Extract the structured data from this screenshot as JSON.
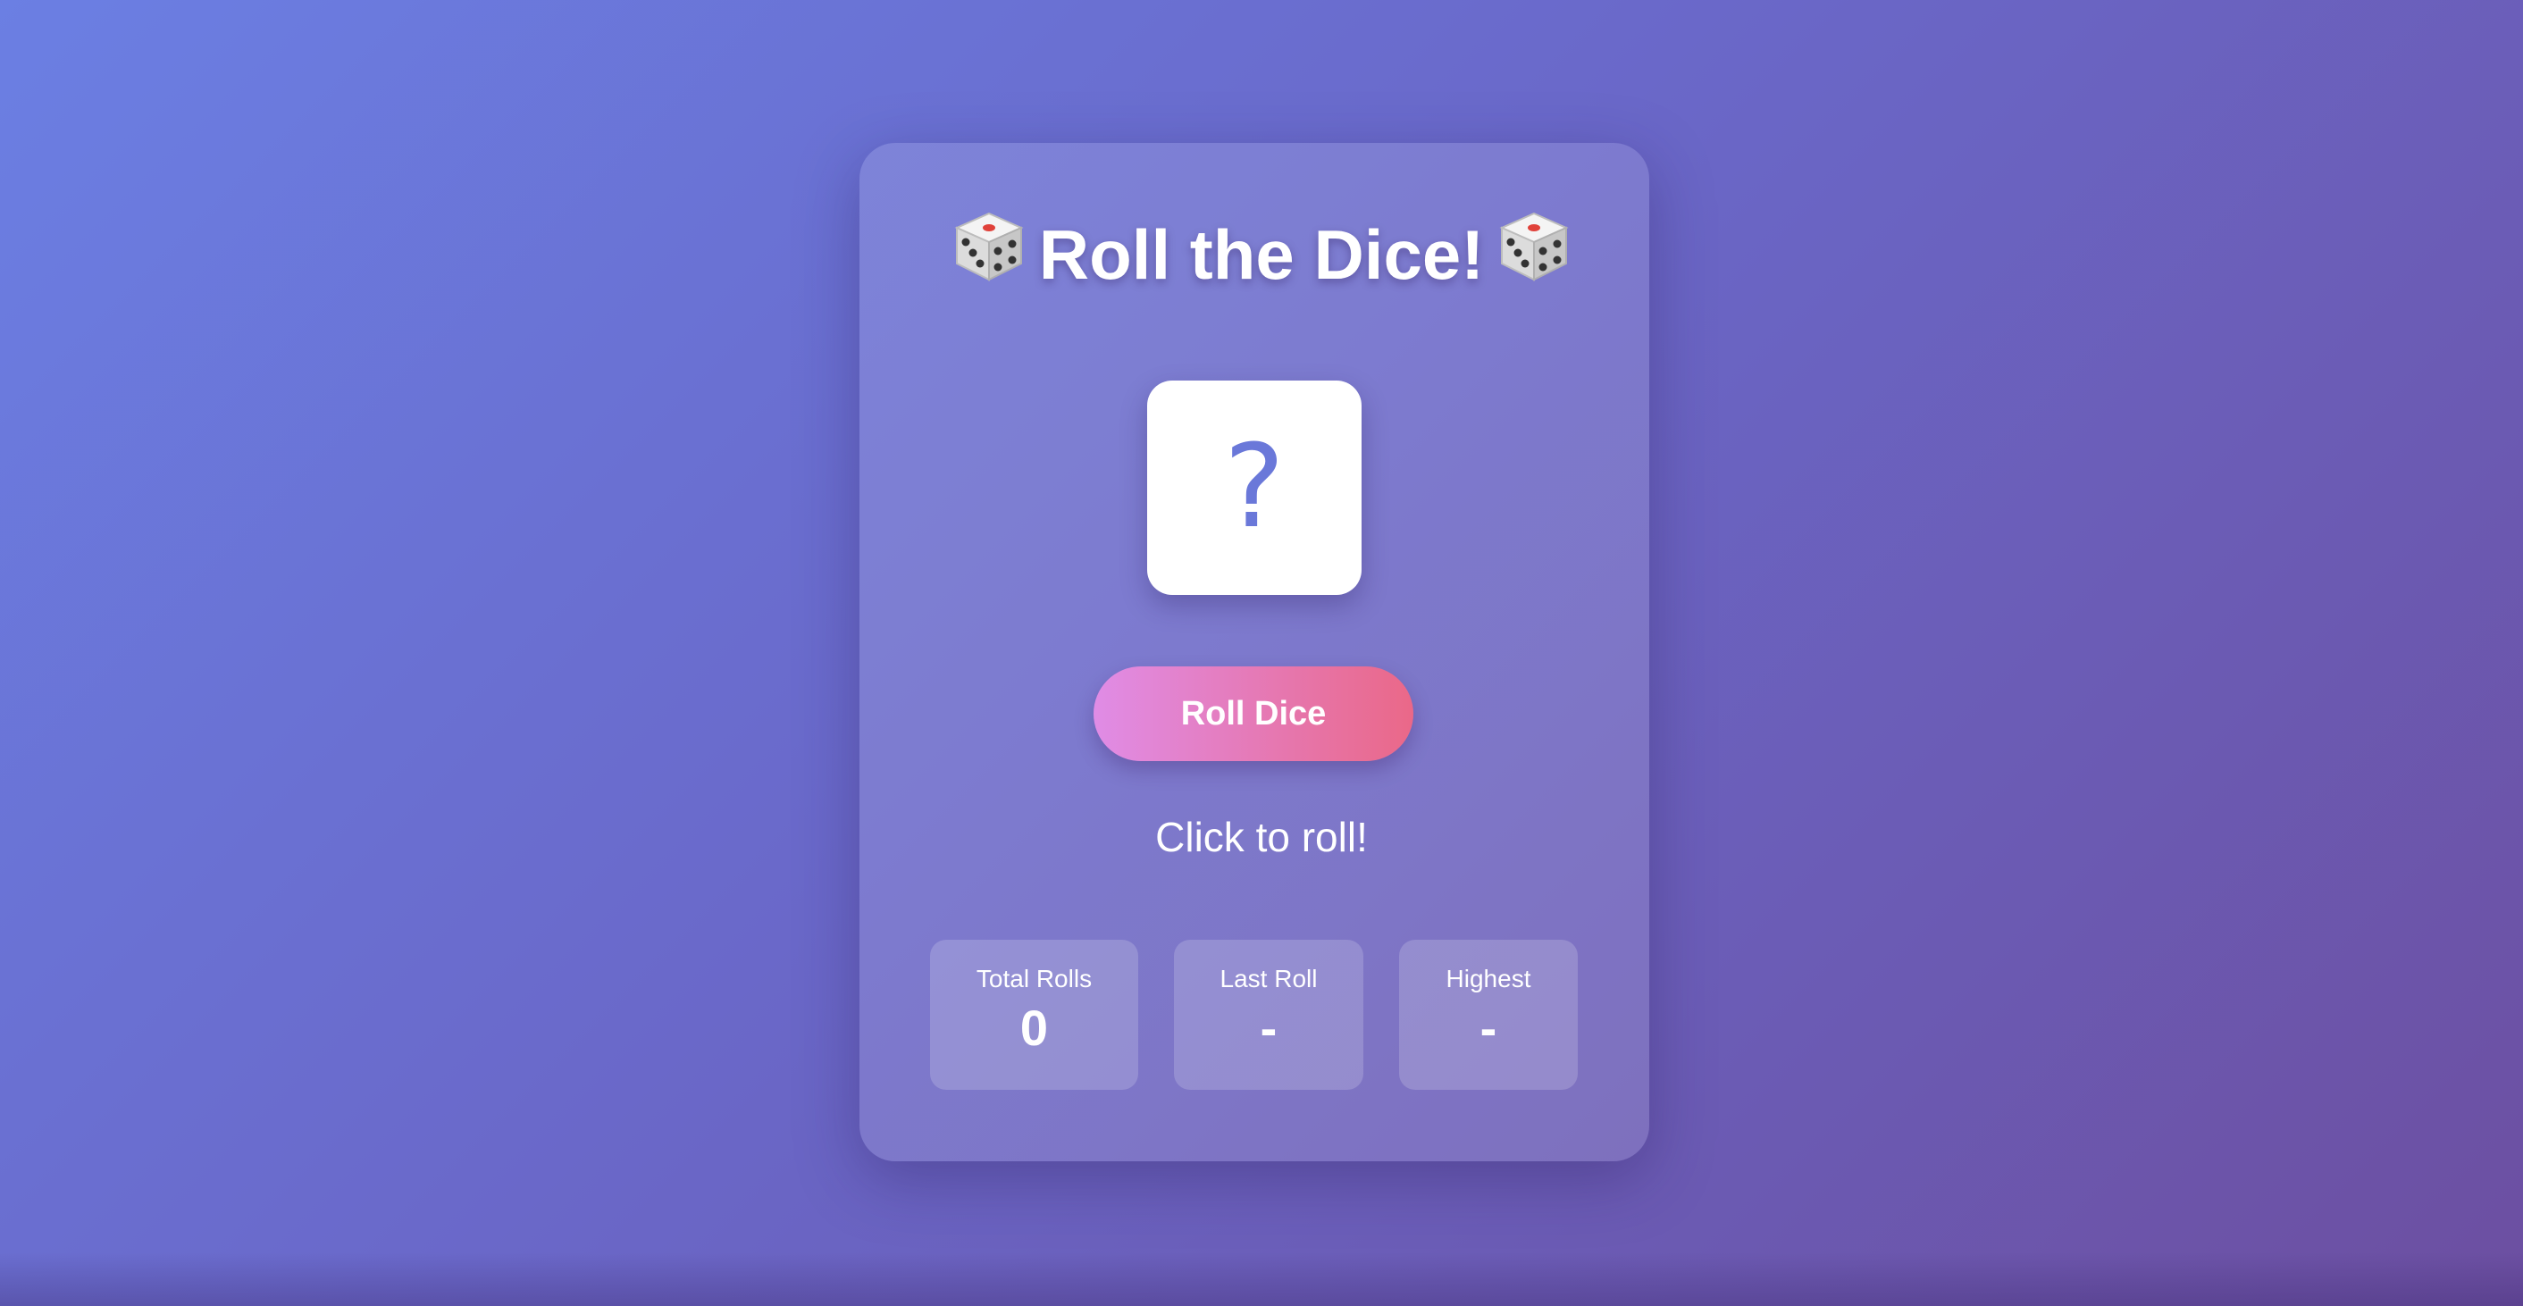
{
  "title": {
    "text": "Roll the Dice!",
    "left_icon": "game-die-icon",
    "right_icon": "game-die-icon"
  },
  "dice": {
    "value": "?"
  },
  "roll_button": {
    "label": "Roll Dice"
  },
  "result": {
    "text": "Click to roll!"
  },
  "stats": [
    {
      "label": "Total Rolls",
      "value": "0"
    },
    {
      "label": "Last Roll",
      "value": "-"
    },
    {
      "label": "Highest",
      "value": "-"
    }
  ],
  "colors": {
    "background_start": "#6b7fe3",
    "background_end": "#6c4fa1",
    "dice_text": "#6a78d9",
    "button_start": "#e08ce6",
    "button_end": "#ea6888"
  }
}
